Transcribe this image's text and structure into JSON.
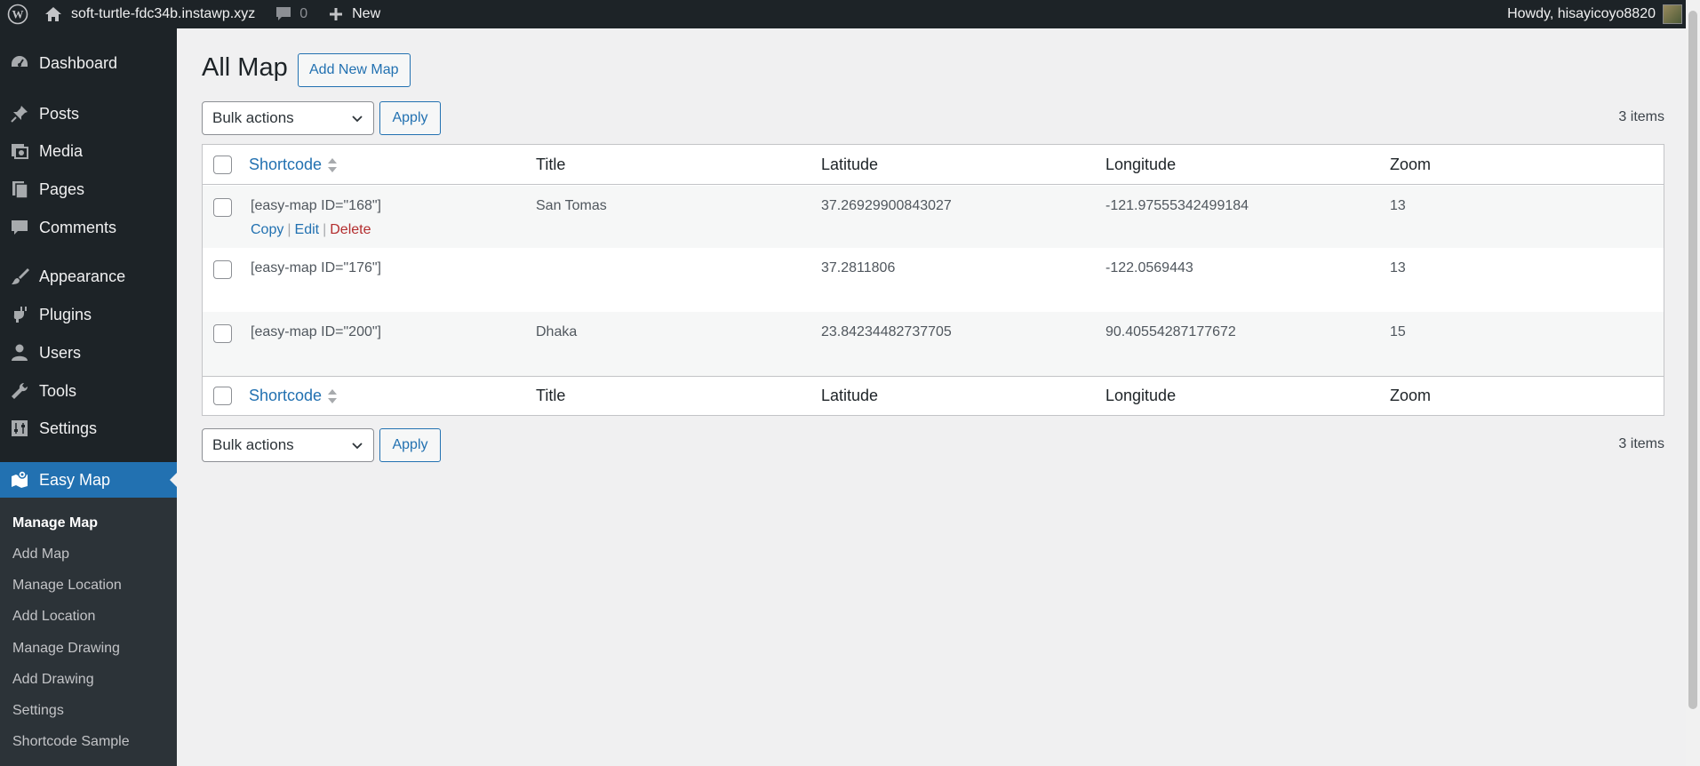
{
  "adminbar": {
    "site_name": "soft-turtle-fdc34b.instawp.xyz",
    "comments_count": "0",
    "new_label": "New",
    "howdy": "Howdy, hisayicoyo8820"
  },
  "sidebar": {
    "items": [
      {
        "label": "Dashboard",
        "icon": "dashboard-icon"
      },
      {
        "label": "Posts",
        "icon": "pin-icon"
      },
      {
        "label": "Media",
        "icon": "media-icon"
      },
      {
        "label": "Pages",
        "icon": "pages-icon"
      },
      {
        "label": "Comments",
        "icon": "comment-icon"
      },
      {
        "label": "Appearance",
        "icon": "brush-icon"
      },
      {
        "label": "Plugins",
        "icon": "plugin-icon"
      },
      {
        "label": "Users",
        "icon": "user-icon"
      },
      {
        "label": "Tools",
        "icon": "wrench-icon"
      },
      {
        "label": "Settings",
        "icon": "sliders-icon"
      },
      {
        "label": "Easy Map",
        "icon": "map-icon"
      }
    ],
    "submenu": [
      "Manage Map",
      "Add Map",
      "Manage Location",
      "Add Location",
      "Manage Drawing",
      "Add Drawing",
      "Settings",
      "Shortcode Sample"
    ]
  },
  "page": {
    "title": "All Map",
    "add_new_label": "Add New Map",
    "bulk_actions_label": "Bulk actions",
    "apply_label": "Apply",
    "items_count": "3 items"
  },
  "table": {
    "columns": [
      "Shortcode",
      "Title",
      "Latitude",
      "Longitude",
      "Zoom"
    ],
    "rows": [
      {
        "shortcode": "[easy-map ID=\"168\"]",
        "title": "San Tomas",
        "latitude": "37.26929900843027",
        "longitude": "-121.97555342499184",
        "zoom": "13"
      },
      {
        "shortcode": "[easy-map ID=\"176\"]",
        "title": "",
        "latitude": "37.2811806",
        "longitude": "-122.0569443",
        "zoom": "13"
      },
      {
        "shortcode": "[easy-map ID=\"200\"]",
        "title": "Dhaka",
        "latitude": "23.84234482737705",
        "longitude": "90.40554287177672",
        "zoom": "15"
      }
    ],
    "row_actions": {
      "copy": "Copy",
      "edit": "Edit",
      "delete": "Delete",
      "separator": "|"
    }
  },
  "colors": {
    "accent": "#2271b1",
    "sidebar_bg": "#1d2327",
    "delete": "#b32d2e"
  }
}
